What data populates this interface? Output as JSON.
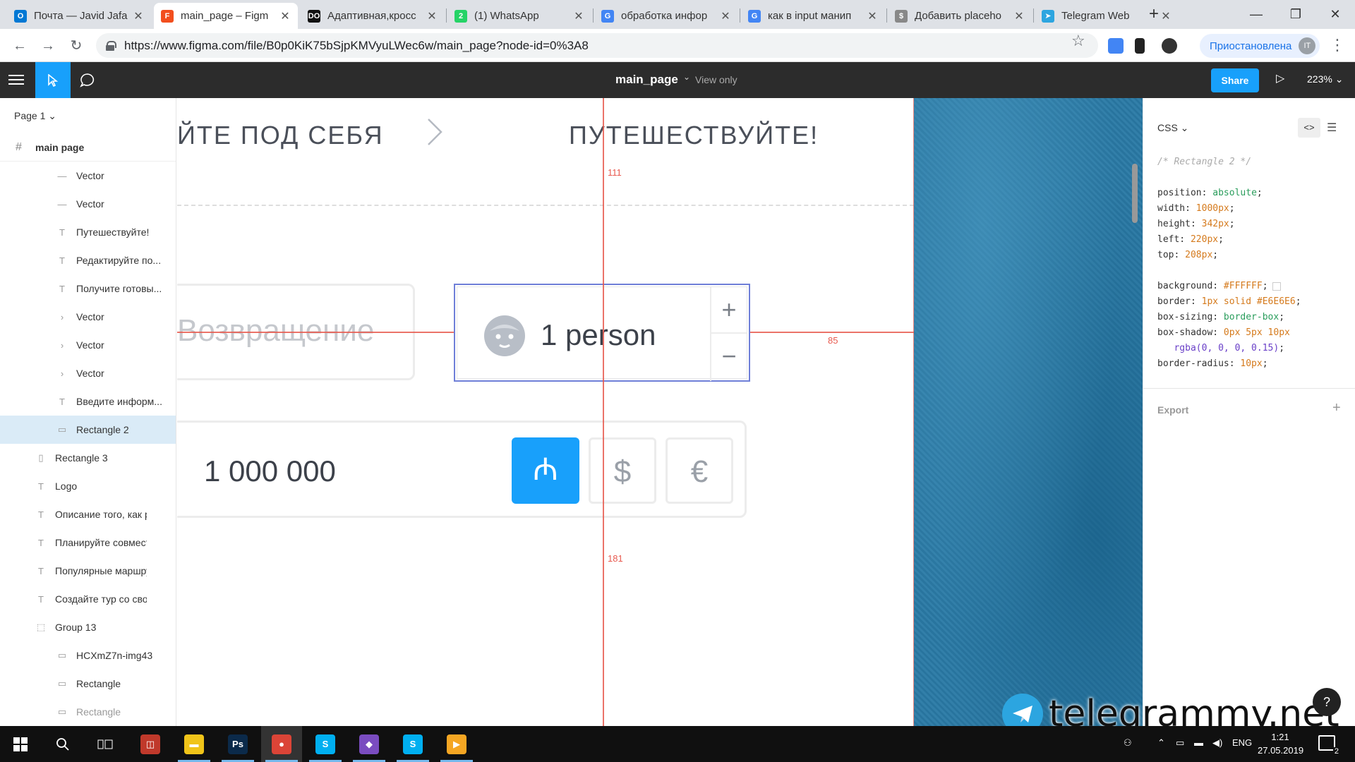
{
  "browser": {
    "tabs": [
      {
        "title": "Почта — Javid Jafa",
        "color": "#0078d4",
        "glyph": "O"
      },
      {
        "title": "main_page – Figm",
        "color": "#f24e1e",
        "glyph": "F",
        "active": true
      },
      {
        "title": "Адаптивная,кросс",
        "color": "#111111",
        "glyph": "DO"
      },
      {
        "title": "(1) WhatsApp",
        "color": "#25d366",
        "glyph": "2"
      },
      {
        "title": "обработка инфор",
        "color": "#4285f4",
        "glyph": "G"
      },
      {
        "title": "как в input манип",
        "color": "#4285f4",
        "glyph": "G"
      },
      {
        "title": "Добавить placeho",
        "color": "#888888",
        "glyph": "$"
      },
      {
        "title": "Telegram Web",
        "color": "#2ca5e0",
        "glyph": "➤"
      }
    ],
    "url": "https://www.figma.com/file/B0p0KiK75bSjpKMVyuLWec6w/main_page?node-id=0%3A8",
    "profile_label": "Приостановлена",
    "profile_initials": "IT"
  },
  "figma": {
    "file_name": "main_page",
    "view_mode": "View only",
    "share_label": "Share",
    "zoom": "223%"
  },
  "layers": {
    "page": "Page 1",
    "root": "main page",
    "items": [
      {
        "icon": "line",
        "name": "Vector",
        "indent": 2
      },
      {
        "icon": "line",
        "name": "Vector",
        "indent": 2
      },
      {
        "icon": "text",
        "name": "Путешествуйте!",
        "indent": 2
      },
      {
        "icon": "text",
        "name": "Редактируйте по...",
        "indent": 2
      },
      {
        "icon": "text",
        "name": "Получите готовы...",
        "indent": 2
      },
      {
        "icon": "chevron",
        "name": "Vector",
        "indent": 2
      },
      {
        "icon": "chevron",
        "name": "Vector",
        "indent": 2
      },
      {
        "icon": "chevron",
        "name": "Vector",
        "indent": 2
      },
      {
        "icon": "text",
        "name": "Введите информ...",
        "indent": 2
      },
      {
        "icon": "rect",
        "name": "Rectangle 2",
        "indent": 2,
        "selected": true
      },
      {
        "icon": "rect-v",
        "name": "Rectangle 3",
        "indent": 1
      },
      {
        "icon": "text",
        "name": "Logo",
        "indent": 1
      },
      {
        "icon": "text",
        "name": "Описание того, как р...",
        "indent": 1
      },
      {
        "icon": "text",
        "name": "Планируйте совмест...",
        "indent": 1
      },
      {
        "icon": "text",
        "name": "Популярные маршру...",
        "indent": 1
      },
      {
        "icon": "text",
        "name": "Создайте тур со свои...",
        "indent": 1
      },
      {
        "icon": "group",
        "name": "Group 13",
        "indent": 1
      },
      {
        "icon": "rect",
        "name": "HCXmZ7n-img43",
        "indent": 2
      },
      {
        "icon": "rect",
        "name": "Rectangle",
        "indent": 2
      },
      {
        "icon": "rect",
        "name": "Rectangle",
        "indent": 2,
        "dim": true
      }
    ]
  },
  "canvas": {
    "heading_left": "ЙТЕ ПОД СЕБЯ",
    "heading_right": "ПУТЕШЕСТВУЙТЕ!",
    "return_placeholder": "Возвращение",
    "person_value": "1 person",
    "plus": "+",
    "minus": "−",
    "amount_value": "1 000 000",
    "currencies": [
      "₼",
      "$",
      "€"
    ],
    "measure_top": "111",
    "measure_right": "85",
    "measure_bottom": "181"
  },
  "inspector": {
    "language": "CSS",
    "comment": "/* Rectangle 2 */",
    "props": [
      {
        "k": "position",
        "v": "absolute",
        "t": "kw"
      },
      {
        "k": "width",
        "v": "1000px",
        "t": "val"
      },
      {
        "k": "height",
        "v": "342px",
        "t": "val"
      },
      {
        "k": "left",
        "v": "220px",
        "t": "val"
      },
      {
        "k": "top",
        "v": "208px",
        "t": "val"
      }
    ],
    "props2": [
      {
        "k": "background",
        "v": "#FFFFFF",
        "t": "val"
      },
      {
        "k": "border",
        "v": "1px solid #E6E6E6",
        "t": "val"
      },
      {
        "k": "box-sizing",
        "v": "border-box",
        "t": "kw"
      },
      {
        "k": "box-shadow",
        "v": "0px 5px 10px",
        "t": "val"
      }
    ],
    "shadow_rgba": "rgba(0, 0, 0, 0.15)",
    "radius": {
      "k": "border-radius",
      "v": "10px"
    },
    "export_label": "Export"
  },
  "watermark": "telegrammy.net",
  "taskbar": {
    "apps": [
      {
        "name": "explorer-app",
        "color": "#f0c419",
        "glyph": "▬"
      },
      {
        "name": "photoshop-app",
        "color": "#0b2a4a",
        "glyph": "Ps"
      },
      {
        "name": "chrome-app",
        "color": "#db4437",
        "glyph": "●",
        "active": true
      },
      {
        "name": "skype-app-1",
        "color": "#00aff0",
        "glyph": "S"
      },
      {
        "name": "game-app",
        "color": "#7a4cc0",
        "glyph": "◆"
      },
      {
        "name": "skype-app-2",
        "color": "#00aff0",
        "glyph": "S"
      },
      {
        "name": "media-app",
        "color": "#f5a623",
        "glyph": "▶"
      }
    ],
    "lang": "ENG",
    "time": "1:21",
    "date": "27.05.2019",
    "notifications": "2"
  },
  "colors": {
    "figma_blue": "#18A0FB",
    "toolbar_bg": "#2C2C2C",
    "redline": "#E85A4F"
  }
}
